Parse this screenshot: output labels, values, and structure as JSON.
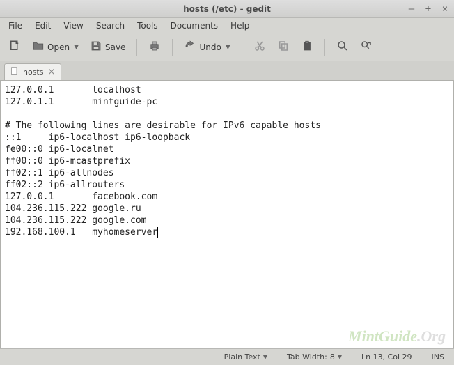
{
  "window": {
    "title": "hosts (/etc) - gedit"
  },
  "menu": {
    "file": "File",
    "edit": "Edit",
    "view": "View",
    "search": "Search",
    "tools": "Tools",
    "documents": "Documents",
    "help": "Help"
  },
  "toolbar": {
    "open_label": "Open",
    "save_label": "Save",
    "undo_label": "Undo"
  },
  "tabs": [
    {
      "label": "hosts"
    }
  ],
  "editor": {
    "content": "127.0.0.1       localhost\n127.0.1.1       mintguide-pc\n\n# The following lines are desirable for IPv6 capable hosts\n::1     ip6-localhost ip6-loopback\nfe00::0 ip6-localnet\nff00::0 ip6-mcastprefix\nff02::1 ip6-allnodes\nff02::2 ip6-allrouters\n127.0.0.1       facebook.com\n104.236.115.222 google.ru\n104.236.115.222 google.com\n192.168.100.1   myhomeserver"
  },
  "status": {
    "syntax": "Plain Text",
    "tabwidth_label": "Tab Width:",
    "tabwidth_value": "8",
    "position": "Ln 13, Col 29",
    "mode": "INS"
  },
  "watermark": {
    "a": "MintGuide",
    "b": ".Org"
  }
}
